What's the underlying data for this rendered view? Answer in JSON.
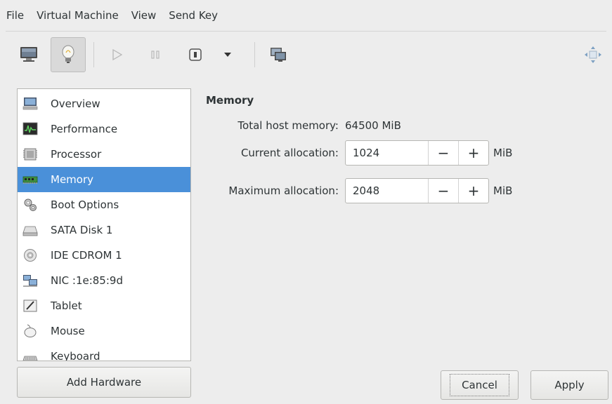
{
  "menubar": {
    "items": [
      "File",
      "Virtual Machine",
      "View",
      "Send Key"
    ]
  },
  "toolbar": {
    "buttons": [
      {
        "icon": "monitor-icon"
      },
      {
        "icon": "lightbulb-icon",
        "pressed": true
      },
      {
        "icon": "play-icon"
      },
      {
        "icon": "pause-icon"
      },
      {
        "icon": "power-icon"
      },
      {
        "icon": "dropdown-arrow-icon"
      },
      {
        "icon": "screenshot-console-icon"
      },
      {
        "icon": "resize-move-icon"
      }
    ]
  },
  "hardware": {
    "items": [
      {
        "label": "Overview",
        "icon": "computer-icon"
      },
      {
        "label": "Performance",
        "icon": "performance-monitor-icon"
      },
      {
        "label": "Processor",
        "icon": "cpu-chip-icon"
      },
      {
        "label": "Memory",
        "icon": "ram-module-icon",
        "selected": true
      },
      {
        "label": "Boot Options",
        "icon": "gears-icon"
      },
      {
        "label": "SATA Disk 1",
        "icon": "hard-disk-icon"
      },
      {
        "label": "IDE CDROM 1",
        "icon": "cdrom-icon"
      },
      {
        "label": "NIC :1e:85:9d",
        "icon": "network-icon"
      },
      {
        "label": "Tablet",
        "icon": "tablet-icon"
      },
      {
        "label": "Mouse",
        "icon": "mouse-icon"
      },
      {
        "label": "Keyboard",
        "icon": "keyboard-icon"
      }
    ],
    "add_button": "Add Hardware"
  },
  "memory": {
    "title": "Memory",
    "total_label": "Total host memory:",
    "total_value": "64500 MiB",
    "current_label": "Current allocation:",
    "current_value": "1024",
    "maximum_label": "Maximum allocation:",
    "maximum_value": "2048",
    "unit": "MiB",
    "minus": "−",
    "plus": "+"
  },
  "actions": {
    "cancel": "Cancel",
    "apply": "Apply"
  },
  "colors": {
    "selection": "#4a90d9",
    "background": "#ededed"
  }
}
